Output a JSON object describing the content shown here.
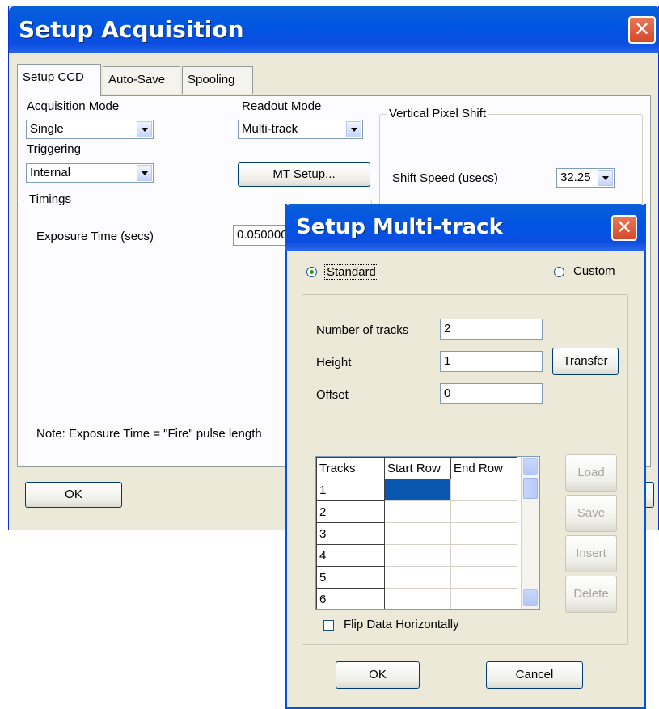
{
  "main": {
    "title": "Setup Acquisition",
    "close_label": "✕",
    "tabs": [
      {
        "label": "Setup CCD"
      },
      {
        "label": "Auto-Save"
      },
      {
        "label": "Spooling"
      }
    ],
    "acquisition_mode": {
      "label": "Acquisition Mode",
      "value": "Single"
    },
    "readout_mode": {
      "label": "Readout Mode",
      "value": "Multi-track"
    },
    "triggering": {
      "label": "Triggering",
      "value": "Internal"
    },
    "mt_setup_label": "MT Setup...",
    "vertical_pixel_shift": {
      "title": "Vertical Pixel Shift",
      "shift_speed_label": "Shift Speed (usecs)",
      "shift_speed_value": "32.25"
    },
    "timings": {
      "title": "Timings",
      "exposure_label": "Exposure Time (secs)",
      "exposure_value": "0.050000"
    },
    "note": "Note: Exposure Time = \"Fire\" pulse length",
    "ok_label": "OK"
  },
  "multitrack": {
    "title": "Setup Multi-track",
    "close_label": "✕",
    "standard_label": "Standard",
    "custom_label": "Custom",
    "selected_mode": "Standard",
    "number_of_tracks": {
      "label": "Number of tracks",
      "value": "2"
    },
    "height": {
      "label": "Height",
      "value": "1"
    },
    "offset": {
      "label": "Offset",
      "value": "0"
    },
    "transfer_label": "Transfer",
    "table": {
      "columns": [
        "Tracks",
        "Start Row",
        "End Row"
      ],
      "rows": [
        "1",
        "2",
        "3",
        "4",
        "5",
        "6"
      ]
    },
    "side_buttons": {
      "load": "Load",
      "save": "Save",
      "insert": "Insert",
      "delete": "Delete"
    },
    "flip_label": "Flip Data Horizontally",
    "flip_checked": false,
    "ok_label": "OK",
    "cancel_label": "Cancel"
  }
}
